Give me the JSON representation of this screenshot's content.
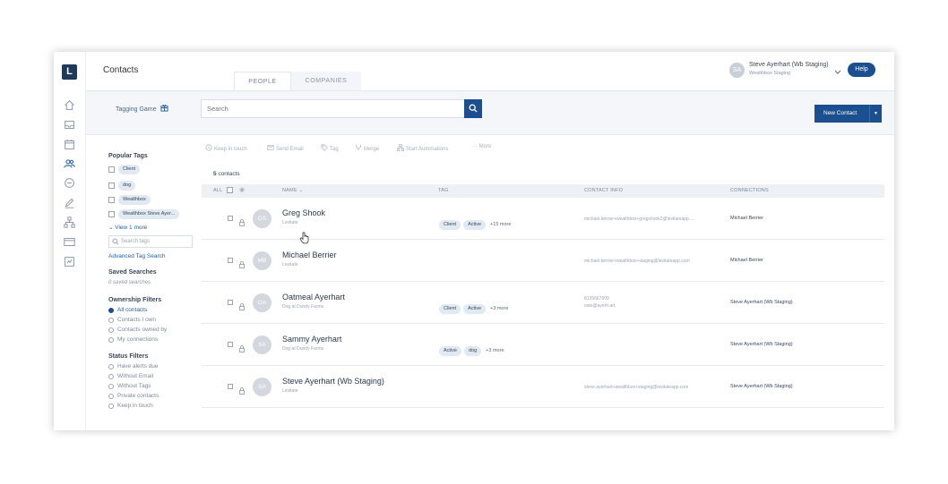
{
  "header": {
    "title": "Contacts",
    "tabs": [
      {
        "label": "PEOPLE"
      },
      {
        "label": "COMPANIES"
      }
    ],
    "user": {
      "initials": "SA",
      "name": "Steve Ayerhart (Wb Staging)",
      "org": "Wealthbox Staging"
    },
    "help_label": "Help"
  },
  "rail": {
    "logo": "L"
  },
  "subbar": {
    "tagging_game": "Tagging Game",
    "search_placeholder": "Search",
    "new_contact": "New Contact"
  },
  "filters": {
    "popular_tags_title": "Popular Tags",
    "tags": [
      "Client",
      "dog",
      "Wealthbox",
      "Wealthbox Steve Ayer..."
    ],
    "view_more": "View 1 more",
    "tag_search_placeholder": "Search tags",
    "advanced_tag_search": "Advanced Tag Search",
    "saved_searches_title": "Saved Searches",
    "saved_searches_empty": "0 saved searches",
    "ownership_title": "Ownership Filters",
    "ownership_options": [
      "All contacts",
      "Contacts I own",
      "Contacts owned by",
      "My connections"
    ],
    "status_title": "Status Filters",
    "status_options": [
      "Have alerts due",
      "Without Email",
      "Without Tags",
      "Private contacts",
      "Keep in touch"
    ]
  },
  "toolbar": {
    "keep_in_touch": "Keep in touch",
    "send_email": "Send Email",
    "tag": "Tag",
    "merge": "Merge",
    "start_automations": "Start Automations",
    "more": "··· More"
  },
  "table": {
    "count_number": "5",
    "count_label": "contacts",
    "columns": {
      "all": "ALL",
      "name": "NAME",
      "tag": "TAG",
      "contact_info": "CONTACT INFO",
      "connections": "CONNECTIONS"
    },
    "rows": [
      {
        "initials": "GS",
        "name": "Greg Shook",
        "sub": "Levitate",
        "tags": [
          "Client",
          "Active"
        ],
        "more": "+15 more",
        "contact1": "michael.berrier+wealthbox+gregshook2@levitateapp....",
        "contact2": "",
        "connection": "Michael Berrier"
      },
      {
        "initials": "MB",
        "name": "Michael Berrier",
        "sub": "Levitate",
        "tags": [],
        "more": "",
        "contact1": "michael.berrier+wealthbox+staging@levitateapp.com",
        "contact2": "",
        "connection": "Michael Berrier"
      },
      {
        "initials": "OA",
        "name": "Oatmeal Ayerhart",
        "sub": "Dog at Dundy Farms",
        "tags": [
          "Client",
          "Active"
        ],
        "more": "+3 more",
        "contact1": "8135667609",
        "contact2": "oats@ayerh.art",
        "connection": "Steve Ayerhart (Wb Staging)"
      },
      {
        "initials": "SA",
        "name": "Sammy Ayerhart",
        "sub": "Dog at Dundy Farms",
        "tags": [
          "Active",
          "dog"
        ],
        "more": "+3 more",
        "contact1": "",
        "contact2": "",
        "connection": "Steve Ayerhart (Wb Staging)"
      },
      {
        "initials": "SA",
        "name": "Steve Ayerhart (Wb Staging)",
        "sub": "Levitate",
        "tags": [],
        "more": "",
        "contact1": "steve.ayerhart+wealthbox+staging@levitateapp.com",
        "contact2": "",
        "connection": "Steve Ayerhart (Wb Staging)"
      }
    ]
  },
  "colors": {
    "primary": "#1c4f8f",
    "tag_chip": "#e1e9f3",
    "subbar_bg": "#f4f6f9"
  }
}
